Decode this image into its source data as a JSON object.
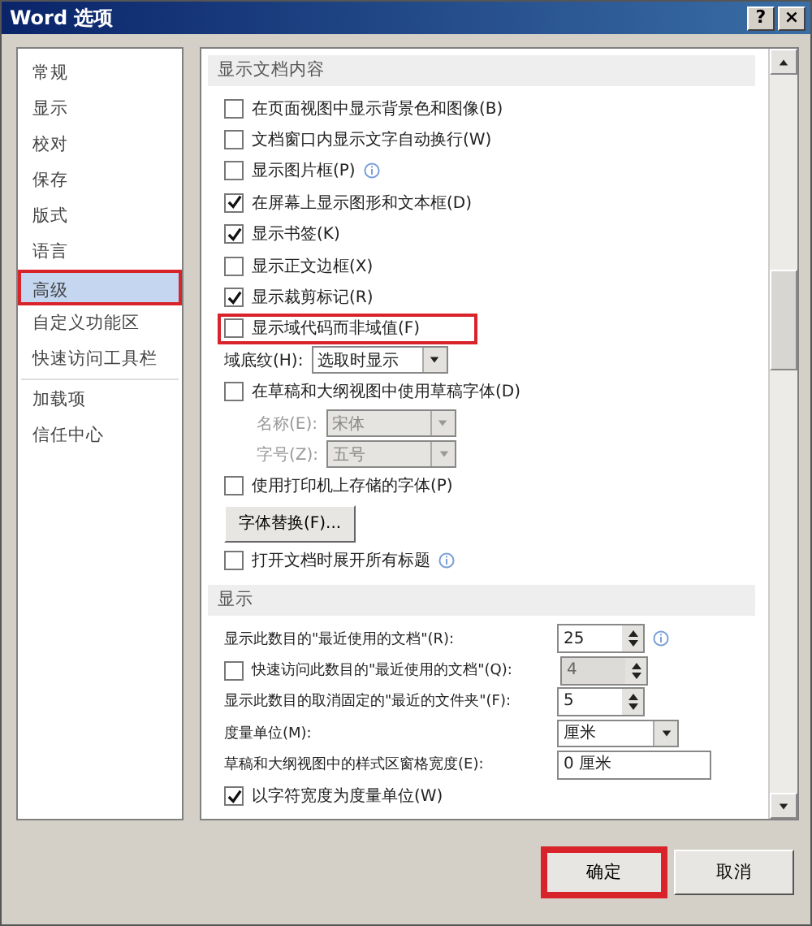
{
  "window": {
    "title": "Word 选项",
    "help": "?",
    "close": "×"
  },
  "sidebar": {
    "items": [
      {
        "label": "常规",
        "selected": false,
        "highlighted": false
      },
      {
        "label": "显示",
        "selected": false,
        "highlighted": false
      },
      {
        "label": "校对",
        "selected": false,
        "highlighted": false
      },
      {
        "label": "保存",
        "selected": false,
        "highlighted": false
      },
      {
        "label": "版式",
        "selected": false,
        "highlighted": false
      },
      {
        "label": "语言",
        "selected": false,
        "highlighted": false
      },
      {
        "label": "高级",
        "selected": true,
        "highlighted": true
      },
      {
        "label": "自定义功能区",
        "selected": false,
        "highlighted": false
      },
      {
        "label": "快速访问工具栏",
        "selected": false,
        "highlighted": false
      },
      {
        "label": "加载项",
        "selected": false,
        "highlighted": false,
        "separator_before": true
      },
      {
        "label": "信任中心",
        "selected": false,
        "highlighted": false
      }
    ]
  },
  "sections": [
    {
      "title": "显示文档内容",
      "rows": [
        {
          "kind": "checkbox",
          "label": "在页面视图中显示背景色和图像(B)",
          "checked": false
        },
        {
          "kind": "checkbox",
          "label": "文档窗口内显示文字自动换行(W)",
          "checked": false
        },
        {
          "kind": "checkbox",
          "label": "显示图片框(P)",
          "checked": false,
          "info": true
        },
        {
          "kind": "checkbox",
          "label": "在屏幕上显示图形和文本框(D)",
          "checked": true
        },
        {
          "kind": "checkbox",
          "label": "显示书签(K)",
          "checked": true
        },
        {
          "kind": "checkbox",
          "label": "显示正文边框(X)",
          "checked": false
        },
        {
          "kind": "checkbox",
          "label": "显示裁剪标记(R)",
          "checked": true
        },
        {
          "kind": "checkbox",
          "label": "显示域代码而非域值(F)",
          "checked": false,
          "highlighted": true
        },
        {
          "kind": "select",
          "label": "域底纹(H):",
          "value": "选取时显示",
          "disabled": false,
          "indent": false
        },
        {
          "kind": "checkbox",
          "label": "在草稿和大纲视图中使用草稿字体(D)",
          "checked": false
        },
        {
          "kind": "select",
          "label": "名称(E):",
          "value": "宋体",
          "disabled": true,
          "indent": true
        },
        {
          "kind": "select",
          "label": "字号(Z):",
          "value": "五号",
          "disabled": true,
          "indent": true
        },
        {
          "kind": "checkbox",
          "label": "使用打印机上存储的字体(P)",
          "checked": false
        },
        {
          "kind": "button",
          "label": "字体替换(F)..."
        },
        {
          "kind": "checkbox",
          "label": "打开文档时展开所有标题",
          "checked": false,
          "info": true
        }
      ]
    },
    {
      "title": "显示",
      "rows": [
        {
          "kind": "spin",
          "label": "显示此数目的\"最近使用的文档\"(R):",
          "value": "25",
          "disabled": false,
          "info": true
        },
        {
          "kind": "checkspin",
          "label": "快速访问此数目的\"最近使用的文档\"(Q):",
          "checked": false,
          "value": "4",
          "disabled": true
        },
        {
          "kind": "spin",
          "label": "显示此数目的取消固定的\"最近的文件夹\"(F):",
          "value": "5",
          "disabled": false
        },
        {
          "kind": "unitselect",
          "label": "度量单位(M):",
          "value": "厘米"
        },
        {
          "kind": "text",
          "label": "草稿和大纲视图中的样式区窗格宽度(E):",
          "value": "0 厘米"
        },
        {
          "kind": "checkbox",
          "label": "以字符宽度为度量单位(W)",
          "checked": true
        }
      ]
    }
  ],
  "buttons": [
    {
      "label": "确定",
      "highlighted": true
    },
    {
      "label": "取消",
      "highlighted": false
    }
  ]
}
